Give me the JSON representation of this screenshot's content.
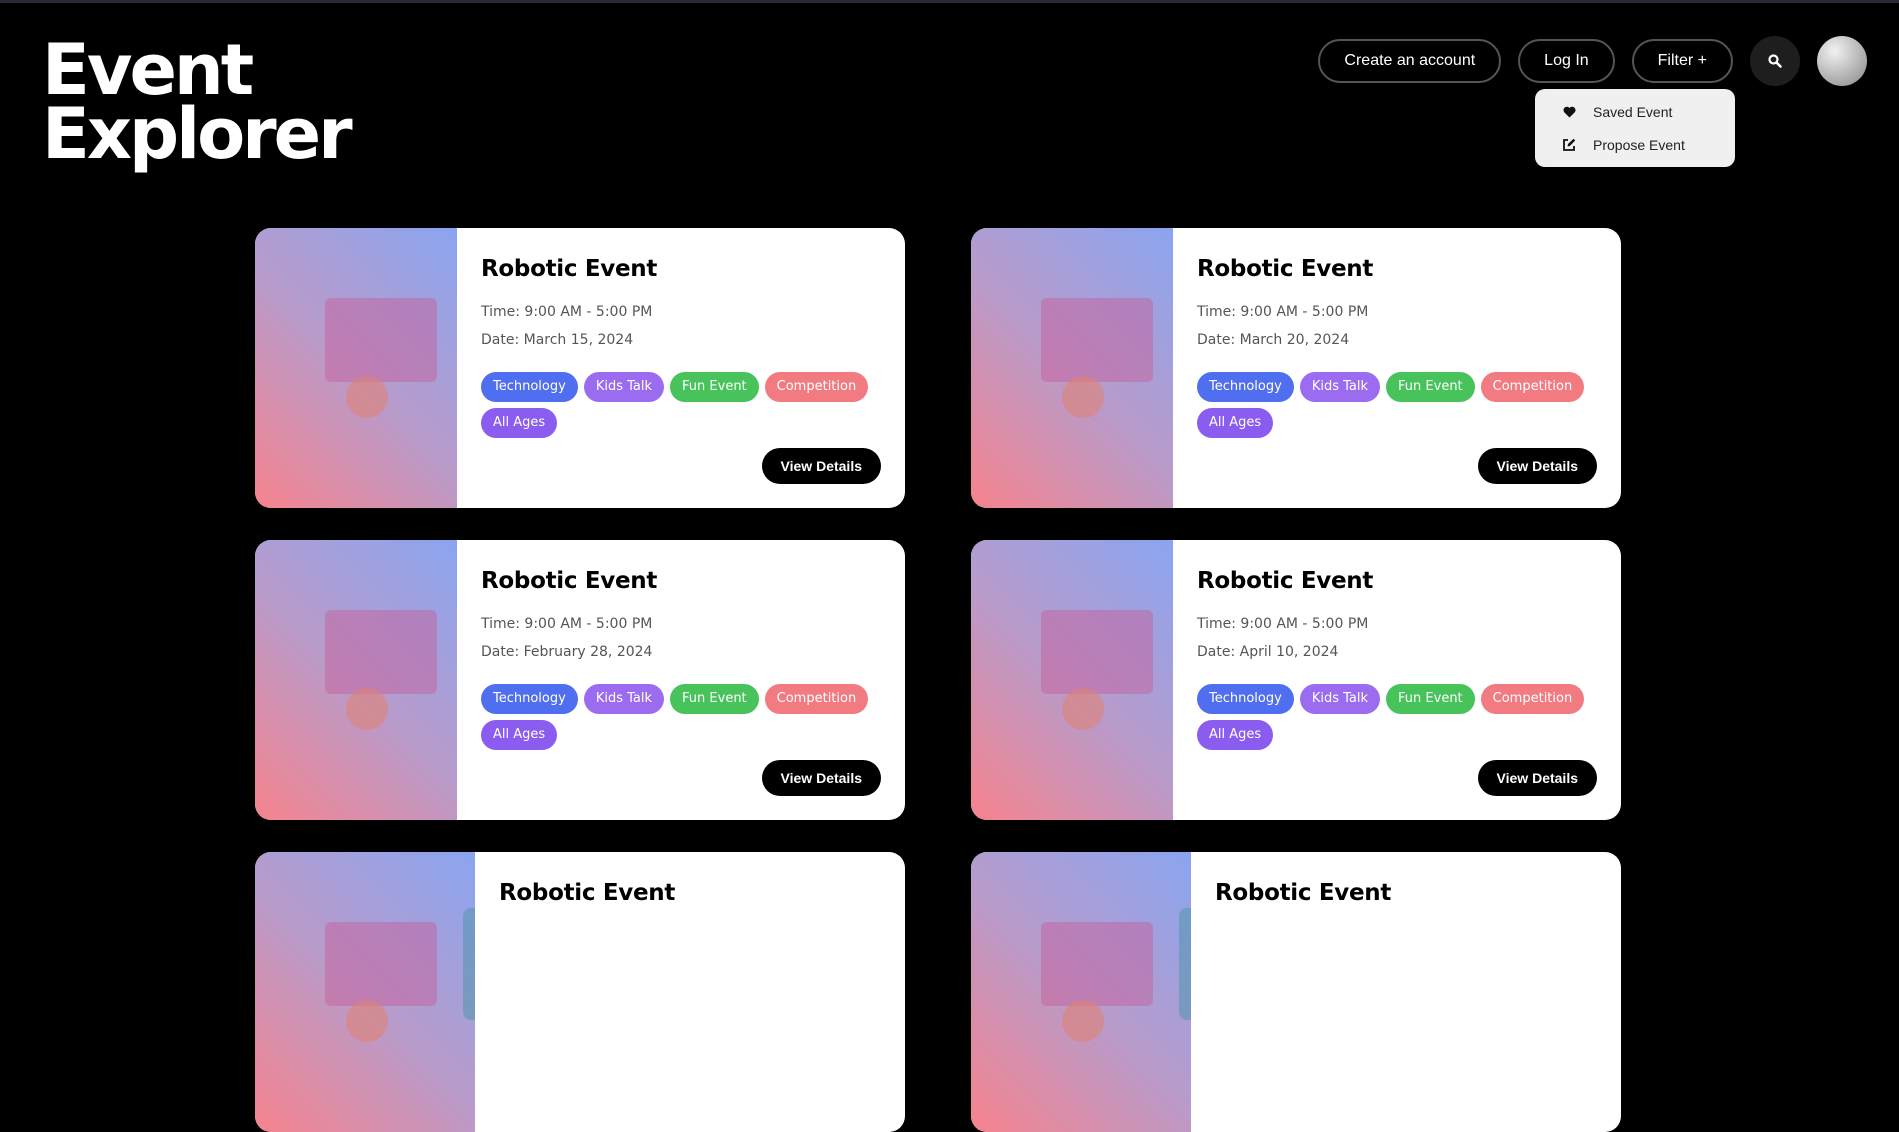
{
  "app": {
    "logo_line1": "Event",
    "logo_line2": "Explorer"
  },
  "nav": {
    "create_account": "Create an account",
    "login": "Log In",
    "filter": "Filter +",
    "search_icon": "search-icon",
    "avatar": "avatar"
  },
  "dropdown": {
    "items": [
      {
        "label": "Saved Event",
        "icon": "heart-icon"
      },
      {
        "label": "Propose Event",
        "icon": "edit-icon"
      }
    ]
  },
  "colors": {
    "tag_technology": "#4f6ef0",
    "tag_kids_talk": "#9b6cf0",
    "tag_fun_event": "#48c35c",
    "tag_competition": "#f27b82",
    "tag_all_ages": "#8b5cf0"
  },
  "events": [
    {
      "title": "Robotic Event",
      "time": "Time: 9:00 AM - 5:00 PM",
      "date": "Date: March 15, 2024",
      "tags": [
        "Technology",
        "Kids Talk",
        "Fun Event",
        "Competition",
        "All Ages"
      ],
      "button": "View Details"
    },
    {
      "title": "Robotic Event",
      "time": "Time: 9:00 AM - 5:00 PM",
      "date": "Date: March 20, 2024",
      "tags": [
        "Technology",
        "Kids Talk",
        "Fun Event",
        "Competition",
        "All Ages"
      ],
      "button": "View Details"
    },
    {
      "title": "Robotic Event",
      "time": "Time: 9:00 AM - 5:00 PM",
      "date": "Date: February 28, 2024",
      "tags": [
        "Technology",
        "Kids Talk",
        "Fun Event",
        "Competition",
        "All Ages"
      ],
      "button": "View Details"
    },
    {
      "title": "Robotic Event",
      "time": "Time: 9:00 AM - 5:00 PM",
      "date": "Date: April 10, 2024",
      "tags": [
        "Technology",
        "Kids Talk",
        "Fun Event",
        "Competition",
        "All Ages"
      ],
      "button": "View Details"
    },
    {
      "title": "Robotic Event"
    },
    {
      "title": "Robotic Event"
    }
  ]
}
